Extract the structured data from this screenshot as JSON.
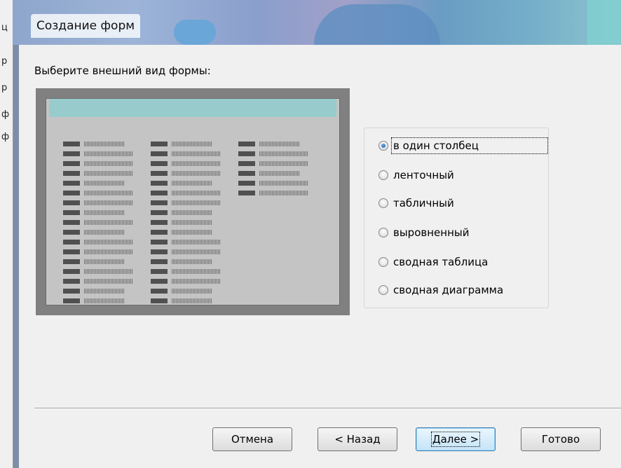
{
  "window": {
    "title": "Создание форм"
  },
  "background": {
    "side_chars": [
      "ц",
      "р",
      "р",
      "ф",
      "ф"
    ]
  },
  "dialog": {
    "prompt": "Выберите внешний вид формы:",
    "options": [
      {
        "label": "в один столбец",
        "checked": true
      },
      {
        "label": "ленточный",
        "checked": false
      },
      {
        "label": "табличный",
        "checked": false
      },
      {
        "label": "выровненный",
        "checked": false
      },
      {
        "label": "сводная таблица",
        "checked": false
      },
      {
        "label": "сводная диаграмма",
        "checked": false
      }
    ],
    "buttons": {
      "cancel": "Отмена",
      "back": "< Назад",
      "next": "Далее >",
      "finish": "Готово"
    }
  },
  "colors": {
    "preview_header": "#98cccc",
    "preview_frame": "#808080"
  }
}
